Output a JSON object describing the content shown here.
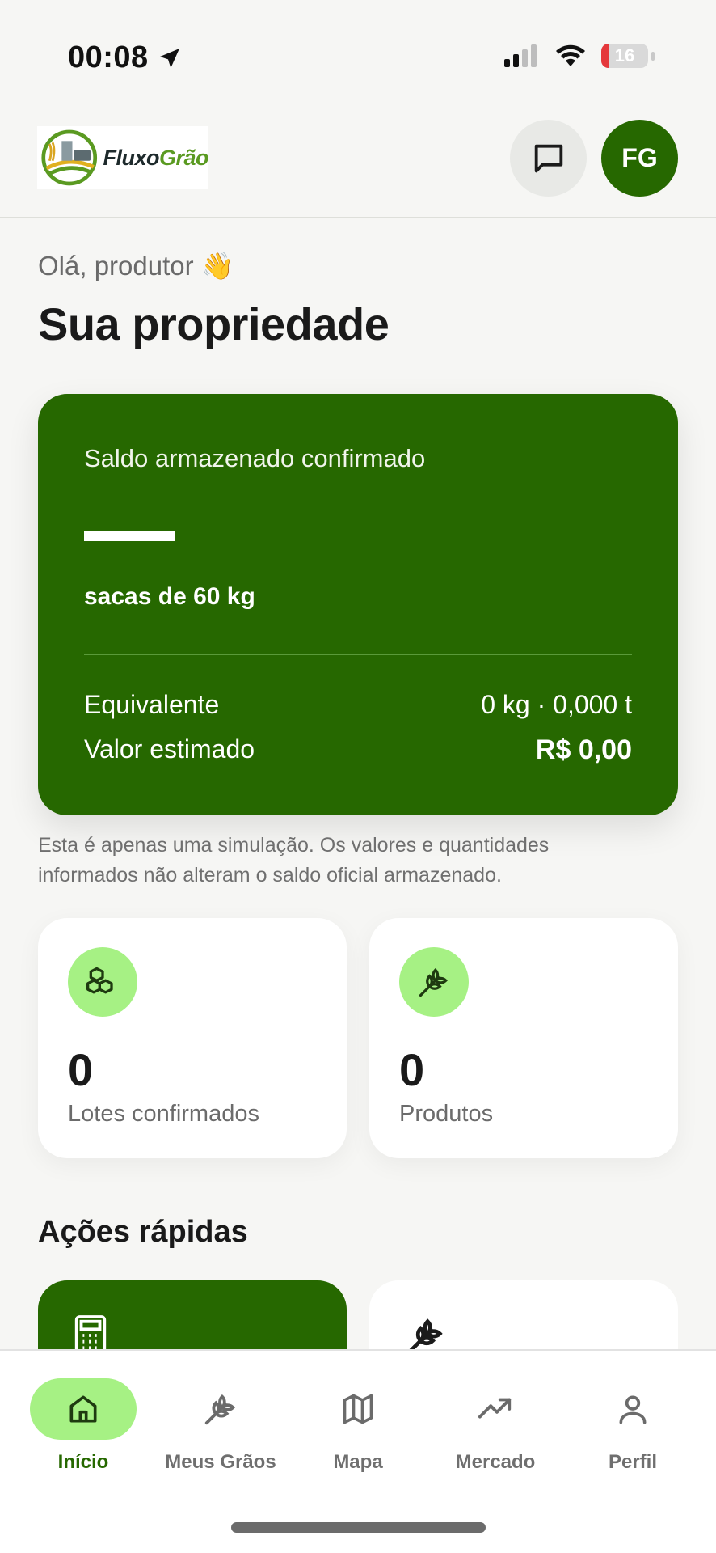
{
  "status_bar": {
    "time": "00:08",
    "battery": "16"
  },
  "header": {
    "logo_text_a": "Fluxo",
    "logo_text_b": "Grão",
    "avatar_initials": "FG"
  },
  "greeting": "Olá, produtor 👋",
  "page_title": "Sua propriedade",
  "balance": {
    "label": "Saldo armazenado confirmado",
    "unit": "sacas de 60 kg",
    "equivalent_label": "Equivalente",
    "equivalent_value": "0 kg · 0,000 t",
    "estimated_label": "Valor estimado",
    "estimated_value": "R$ 0,00"
  },
  "disclaimer": "Esta é apenas uma simulação. Os valores e quantidades informados não alteram o saldo oficial armazenado.",
  "stats": [
    {
      "value": "0",
      "label": "Lotes confirmados",
      "icon": "boxes-icon"
    },
    {
      "value": "0",
      "label": "Produtos",
      "icon": "wheat-icon"
    }
  ],
  "quick_actions_title": "Ações rápidas",
  "nav": [
    {
      "label": "Início",
      "icon": "home-icon",
      "active": true
    },
    {
      "label": "Meus Grãos",
      "icon": "wheat-icon"
    },
    {
      "label": "Mapa",
      "icon": "map-icon"
    },
    {
      "label": "Mercado",
      "icon": "trending-up-icon"
    },
    {
      "label": "Perfil",
      "icon": "user-icon"
    }
  ],
  "colors": {
    "brand": "#266800",
    "accent": "#a6f184"
  }
}
